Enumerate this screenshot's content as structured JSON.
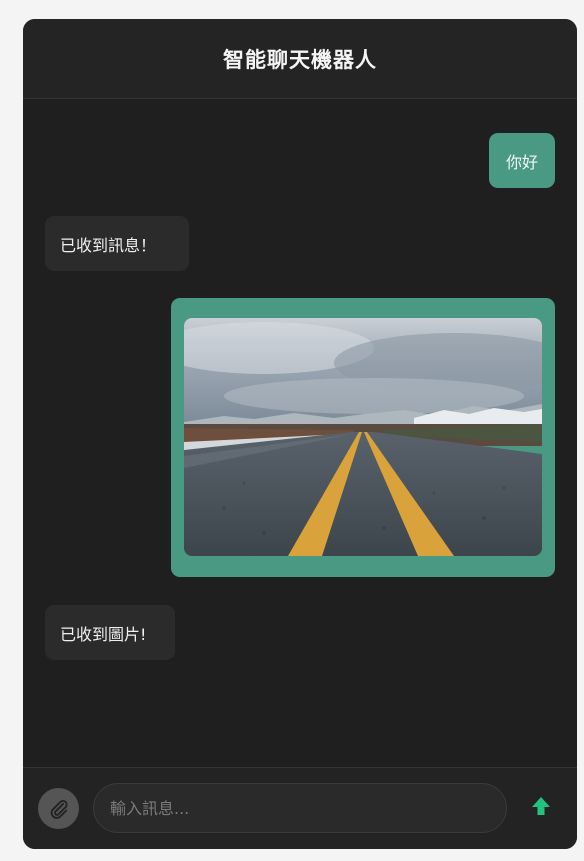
{
  "header": {
    "title": "智能聊天機器人"
  },
  "messages": [
    {
      "sender": "user",
      "type": "text",
      "text": "你好"
    },
    {
      "sender": "bot",
      "type": "text",
      "text": "已收到訊息！"
    },
    {
      "sender": "user",
      "type": "image",
      "image_subject": "asphalt road with double yellow center lines under a cloudy sky"
    },
    {
      "sender": "bot",
      "type": "text",
      "text": "已收到圖片!"
    }
  ],
  "composer": {
    "placeholder": "輸入訊息...",
    "value": "",
    "attach_icon": "paperclip-icon",
    "send_icon": "arrow-up-icon"
  },
  "colors": {
    "page_bg": "#f4f4f5",
    "window_bg": "#1f1f1f",
    "user_bubble": "#4a9a83",
    "bot_bubble": "#2b2b2b",
    "send_arrow": "#22c37e"
  }
}
